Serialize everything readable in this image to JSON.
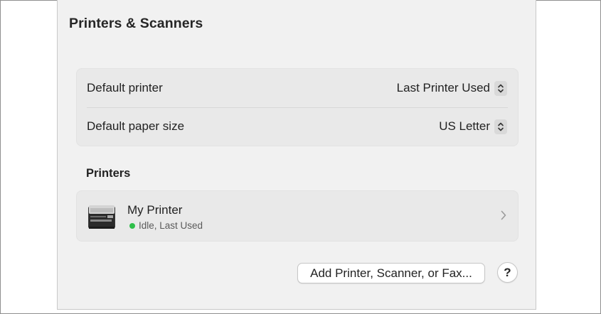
{
  "window": {
    "title": "Printers & Scanners"
  },
  "settings": {
    "default_printer": {
      "label": "Default printer",
      "value": "Last Printer Used"
    },
    "default_paper_size": {
      "label": "Default paper size",
      "value": "US Letter"
    }
  },
  "printers": {
    "section_title": "Printers",
    "items": [
      {
        "name": "My Printer",
        "status": "Idle, Last Used",
        "status_color": "#2fbf4a",
        "icon": "printer-icon"
      }
    ]
  },
  "actions": {
    "add_label": "Add Printer, Scanner, or Fax...",
    "help_label": "?"
  },
  "colors": {
    "panel_bg": "#f1f1f1",
    "group_bg": "#e9e9e9",
    "status_idle": "#2fbf4a"
  }
}
